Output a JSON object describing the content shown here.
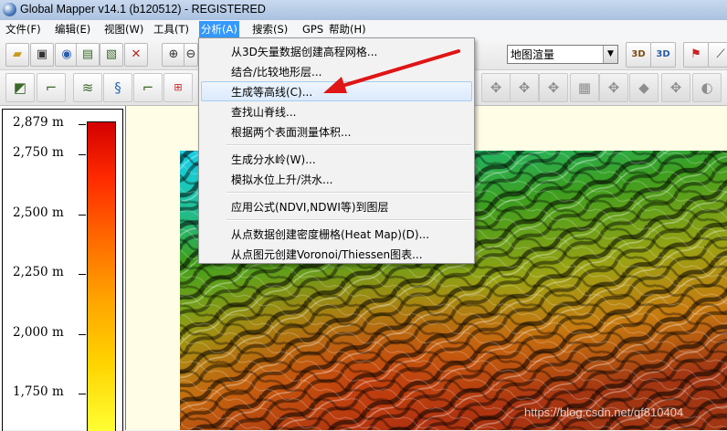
{
  "window": {
    "title": "Global Mapper v14.1 (b120512) - REGISTERED"
  },
  "menubar": {
    "items": [
      {
        "label": "文件(F)"
      },
      {
        "label": "编辑(E)"
      },
      {
        "label": "视图(W)"
      },
      {
        "label": "工具(T)"
      },
      {
        "label": "分析(A)"
      },
      {
        "label": "搜索(S)"
      },
      {
        "label": "GPS"
      },
      {
        "label": "帮助(H)"
      }
    ]
  },
  "toolbar": {
    "render_mode_select": {
      "value": "地图渲量"
    }
  },
  "analysis_menu": {
    "items": [
      {
        "label": "从3D矢量数据创建高程网格..."
      },
      {
        "label": "结合/比较地形层..."
      },
      {
        "label": "生成等高线(C)...",
        "highlighted": true
      },
      {
        "label": "查找山脊线..."
      },
      {
        "label": "根据两个表面测量体积..."
      },
      {
        "label": "生成分水岭(W)..."
      },
      {
        "label": "模拟水位上升/洪水..."
      },
      {
        "label": "应用公式(NDVI,NDWI等)到图层"
      },
      {
        "label": "从点数据创建密度栅格(Heat Map)(D)..."
      },
      {
        "label": "从点图元创建Voronoi/Thiessen图表..."
      }
    ]
  },
  "elevation_legend": {
    "unit": "m",
    "ticks": [
      "2,879 m",
      "2,750 m",
      "2,500 m",
      "2,250 m",
      "2,000 m",
      "1,750 m"
    ],
    "colors": {
      "high": "#d30000",
      "low": "#ffff33"
    }
  },
  "watermark": "https://blog.csdn.net/qf810404"
}
